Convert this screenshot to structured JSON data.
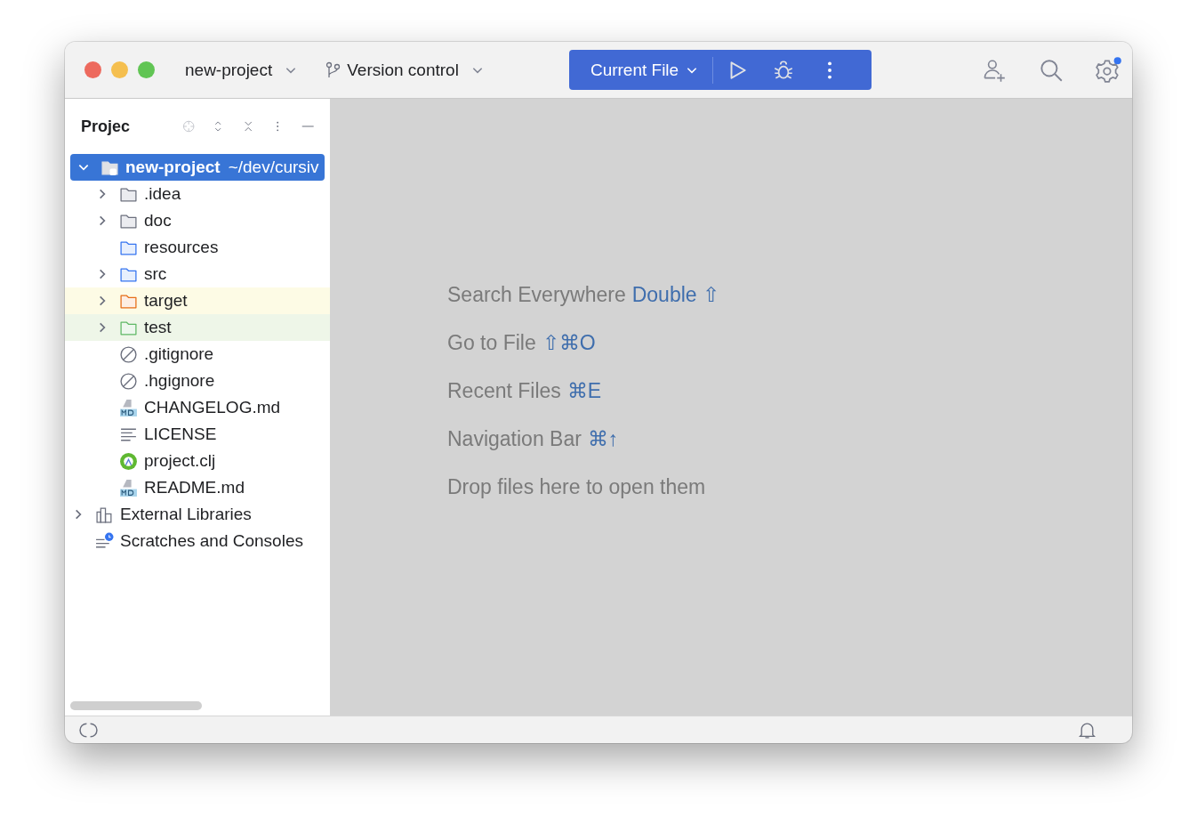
{
  "toolbar": {
    "project": "new-project",
    "vcs": "Version control",
    "run_config": "Current File",
    "settings_badge": true
  },
  "project_panel": {
    "title": "Projec",
    "tree": [
      {
        "name": "new-project",
        "path": "~/dev/cursiv",
        "kind": "module",
        "expanded": true,
        "selected": true,
        "children": [
          {
            "name": ".idea",
            "kind": "folder",
            "expanded": false,
            "selected": false
          },
          {
            "name": "doc",
            "kind": "folder",
            "expanded": false,
            "selected": false
          },
          {
            "name": "resources",
            "kind": "resource-folder",
            "selected": false
          },
          {
            "name": "src",
            "kind": "source-folder",
            "expanded": false,
            "selected": false
          },
          {
            "name": "target",
            "kind": "excluded-folder",
            "expanded": false,
            "selected": false
          },
          {
            "name": "test",
            "kind": "test-folder",
            "expanded": false,
            "selected": false
          },
          {
            "name": ".gitignore",
            "kind": "ignore-file",
            "selected": false
          },
          {
            "name": ".hgignore",
            "kind": "ignore-file",
            "selected": false
          },
          {
            "name": "CHANGELOG.md",
            "kind": "markdown-file",
            "selected": false
          },
          {
            "name": "LICENSE",
            "kind": "text-file",
            "selected": false
          },
          {
            "name": "project.clj",
            "kind": "clojure-file",
            "selected": false
          },
          {
            "name": "README.md",
            "kind": "markdown-file",
            "selected": false
          }
        ]
      },
      {
        "name": "External Libraries",
        "kind": "libraries",
        "expanded": false,
        "selected": false
      },
      {
        "name": "Scratches and Consoles",
        "kind": "scratches",
        "selected": false
      }
    ]
  },
  "editor_hints": [
    {
      "label": "Search Everywhere",
      "shortcut": "Double ⇧"
    },
    {
      "label": "Go to File",
      "shortcut": "⇧⌘O"
    },
    {
      "label": "Recent Files",
      "shortcut": "⌘E"
    },
    {
      "label": "Navigation Bar",
      "shortcut": "⌘↑"
    },
    {
      "label": "Drop files here to open them"
    }
  ]
}
